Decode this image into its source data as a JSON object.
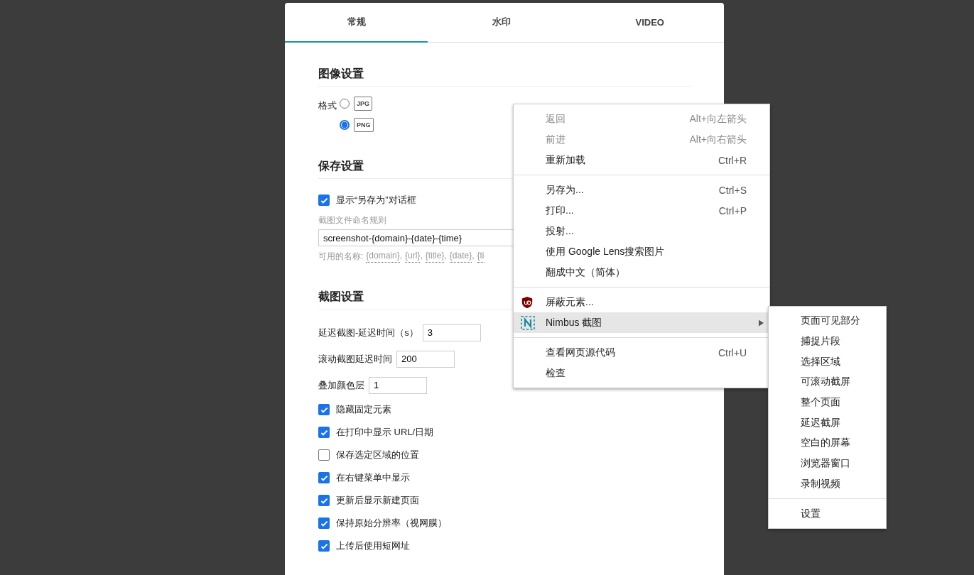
{
  "tabs": [
    {
      "label": "常规",
      "selected": true
    },
    {
      "label": "水印",
      "selected": false
    },
    {
      "label": "VIDEO",
      "selected": false
    }
  ],
  "sections": [
    {
      "title": "图像设置",
      "rows": [
        {
          "kind": "radio-group",
          "label": "格式",
          "options": [
            {
              "label": "JPG",
              "selected": false
            },
            {
              "label": "PNG",
              "selected": true
            }
          ]
        }
      ]
    },
    {
      "title": "保存设置",
      "rows": [
        {
          "kind": "checkbox",
          "label": "显示“另存为”对话框",
          "checked": true
        },
        {
          "kind": "text-field",
          "label": "截图文件命名规则",
          "value": "screenshot-{domain}-{date}-{time}",
          "hint": "可用的名称:",
          "separator": ",",
          "tokens": [
            "{domain}",
            "{url}",
            "{title}",
            "{date}",
            "{ti"
          ]
        }
      ]
    },
    {
      "title": "截图设置",
      "rows": [
        {
          "kind": "number-field",
          "label": "延迟截图-延迟时间（s）",
          "value": "3"
        },
        {
          "kind": "number-field",
          "label": "滚动截图延迟时间",
          "value": "200"
        },
        {
          "kind": "number-field",
          "label": "叠加颜色层",
          "value": "1"
        },
        {
          "kind": "checkbox",
          "label": "隐藏固定元素",
          "checked": true
        },
        {
          "kind": "checkbox",
          "label": "在打印中显示 URL/日期",
          "checked": true
        },
        {
          "kind": "checkbox",
          "label": "保存选定区域的位置",
          "checked": false
        },
        {
          "kind": "checkbox",
          "label": "在右键菜单中显示",
          "checked": true
        },
        {
          "kind": "checkbox",
          "label": "更新后显示新建页面",
          "checked": true
        },
        {
          "kind": "checkbox",
          "label": "保持原始分辨率（视网膜）",
          "checked": true
        },
        {
          "kind": "checkbox",
          "label": "上传后使用短网址",
          "checked": true
        }
      ]
    }
  ],
  "context_menu": {
    "groups": [
      [
        {
          "kind": "plain",
          "label": "返回",
          "shortcut": "Alt+向左箭头",
          "disabled": true,
          "selected": false
        },
        {
          "kind": "plain",
          "label": "前进",
          "shortcut": "Alt+向右箭头",
          "disabled": true,
          "selected": false
        },
        {
          "kind": "plain",
          "label": "重新加载",
          "shortcut": "Ctrl+R",
          "disabled": false,
          "selected": false
        }
      ],
      [
        {
          "kind": "plain",
          "label": "另存为...",
          "shortcut": "Ctrl+S",
          "disabled": false,
          "selected": false
        },
        {
          "kind": "plain",
          "label": "打印...",
          "shortcut": "Ctrl+P",
          "disabled": false,
          "selected": false
        },
        {
          "kind": "plain",
          "label": "投射...",
          "disabled": false,
          "selected": false
        },
        {
          "kind": "plain",
          "label": "使用 Google Lens搜索图片",
          "disabled": false,
          "selected": false
        },
        {
          "kind": "plain",
          "label": "翻成中文（简体）",
          "disabled": false,
          "selected": false
        }
      ],
      [
        {
          "kind": "blocker",
          "label": "屏蔽元素...",
          "disabled": false,
          "selected": false
        },
        {
          "kind": "capture",
          "label": "Nimbus 截图",
          "disabled": false,
          "selected": true,
          "has_submenu": true
        }
      ],
      [
        {
          "kind": "plain",
          "label": "查看网页源代码",
          "shortcut": "Ctrl+U",
          "disabled": false,
          "selected": false
        },
        {
          "kind": "plain",
          "label": "检查",
          "disabled": false,
          "selected": false
        }
      ]
    ]
  },
  "submenu": {
    "groups": [
      [
        "页面可见部分",
        "捕捉片段",
        "选择区域",
        "可滚动截屏",
        "整个页面",
        "延迟截屏",
        "空白的屏幕",
        "浏览器窗口",
        "录制视频"
      ],
      [
        "设置"
      ]
    ]
  }
}
